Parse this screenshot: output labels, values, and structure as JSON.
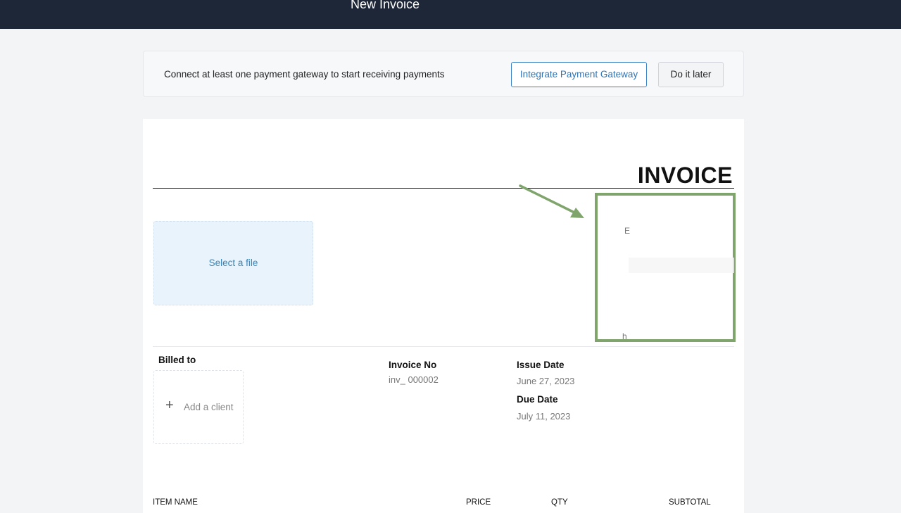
{
  "header": {
    "title": "New Invoice"
  },
  "notice": {
    "message": "Connect at least one payment gateway to start receiving payments",
    "integrate_label": "Integrate Payment Gateway",
    "later_label": "Do it later"
  },
  "invoice": {
    "heading": "INVOICE",
    "select_file_label": "Select a file",
    "company_fragments": [
      "E",
      "h"
    ],
    "billed_to_label": "Billed to",
    "add_client_icon": "+",
    "add_client_label": "Add a client",
    "invoice_no_label": "Invoice No",
    "invoice_no_value": "inv_ 000002",
    "issue_date_label": "Issue Date",
    "issue_date_value": "June 27, 2023",
    "due_date_label": "Due Date",
    "due_date_value": "July 11, 2023",
    "columns": [
      "ITEM NAME",
      "PRICE",
      "QTY",
      "SUBTOTAL"
    ]
  },
  "annotation": {
    "color": "#7fa56c"
  },
  "colors": {
    "topbar": "#1d2737",
    "accent": "#2f74b5",
    "dropzone": "#e8f3fb"
  }
}
